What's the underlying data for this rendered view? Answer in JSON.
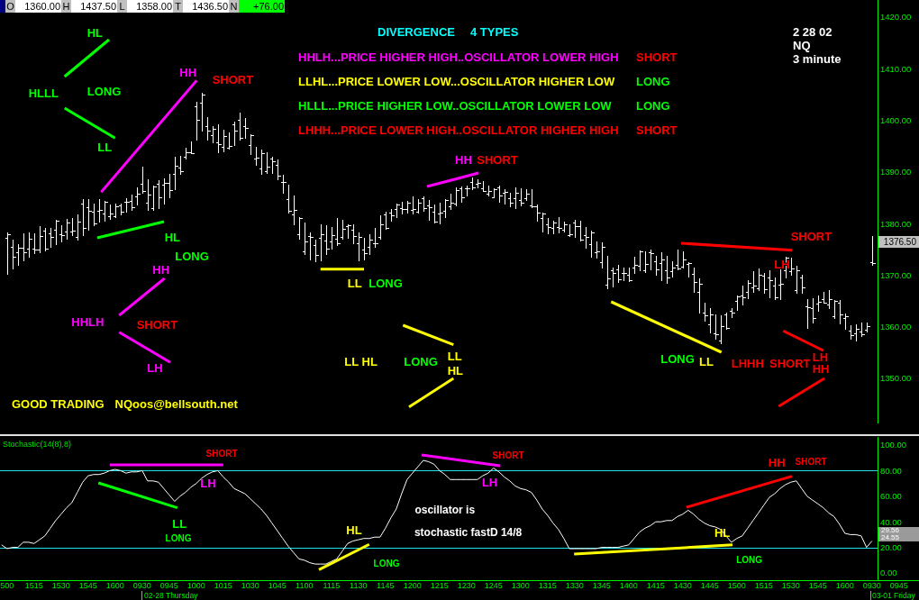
{
  "quote_bar": [
    {
      "label": "O",
      "value": "1360.00",
      "color": "#ffffff"
    },
    {
      "label": "H",
      "value": "1437.50",
      "color": "#ffffff"
    },
    {
      "label": "L",
      "value": "1358.00",
      "color": "#ffffff"
    },
    {
      "label": "T",
      "value": "1436.50",
      "color": "#ffffff"
    },
    {
      "label": "N",
      "value": "+76.00",
      "color": "#00ff00"
    }
  ],
  "price_chart": {
    "legend": {
      "title": "DIVERGENCE",
      "subtitle": "4 TYPES",
      "rows": [
        {
          "text": "HHLH...PRICE HIGHER HIGH..OSCILLATOR LOWER HIGH",
          "color": "#ff00ff",
          "signal": {
            "text": "SHORT",
            "color": "#ff0000"
          }
        },
        {
          "text": "LLHL...PRICE LOWER LOW...OSCILLATOR HIGHER LOW",
          "color": "#ffff00",
          "signal": {
            "text": "LONG",
            "color": "#00ff00"
          }
        },
        {
          "text": "HLLL...PRICE HIGHER LOW..OSCILLATOR LOWER LOW",
          "color": "#00ff00",
          "signal": {
            "text": "LONG",
            "color": "#00ff00"
          }
        },
        {
          "text": "LHHH...PRICE LOWER HIGH..OSCILLATOR HIGHER HIGH",
          "color": "#ff0000",
          "signal": {
            "text": "SHORT",
            "color": "#ff0000"
          }
        }
      ]
    },
    "info": [
      "2 28 02",
      "NQ",
      "3 minute"
    ],
    "labels": [
      {
        "text": "HL",
        "color": "#00ff00"
      },
      {
        "text": "HH",
        "color": "#ff00ff"
      },
      {
        "text": "SHORT",
        "color": "#ff0000"
      },
      {
        "text": "HLLL",
        "color": "#00ff00"
      },
      {
        "text": "LONG",
        "color": "#00ff00"
      },
      {
        "text": "LL",
        "color": "#00ff00"
      },
      {
        "text": "HH",
        "color": "#ff00ff"
      },
      {
        "text": "SHORT",
        "color": "#ff0000"
      },
      {
        "text": "HL",
        "color": "#00ff00"
      },
      {
        "text": "SHORT",
        "color": "#ff0000"
      },
      {
        "text": "LONG",
        "color": "#00ff00"
      },
      {
        "text": "HH",
        "color": "#ff00ff"
      },
      {
        "text": "LH",
        "color": "#ff0000"
      },
      {
        "text": "LL",
        "color": "#ffff00"
      },
      {
        "text": "LONG",
        "color": "#00ff00"
      },
      {
        "text": "HHLH",
        "color": "#ff00ff"
      },
      {
        "text": "SHORT",
        "color": "#ff0000"
      },
      {
        "text": "LH",
        "color": "#ff00ff"
      },
      {
        "text": "LL HL",
        "color": "#ffff00"
      },
      {
        "text": "LONG",
        "color": "#00ff00"
      },
      {
        "text": "LL",
        "color": "#ffff00"
      },
      {
        "text": "HL",
        "color": "#ffff00"
      },
      {
        "text": "LONG",
        "color": "#00ff00"
      },
      {
        "text": "LL",
        "color": "#ffff00"
      },
      {
        "text": "LHHH",
        "color": "#ff0000"
      },
      {
        "text": "SHORT",
        "color": "#ff0000"
      },
      {
        "text": "LH",
        "color": "#ff0000"
      },
      {
        "text": "HH",
        "color": "#ff0000"
      }
    ],
    "lines": [
      {
        "color": "#00ff00"
      },
      {
        "color": "#ff00ff"
      },
      {
        "color": "#00ff00"
      },
      {
        "color": "#ff00ff"
      },
      {
        "color": "#00ff00"
      },
      {
        "color": "#ff0000"
      },
      {
        "color": "#ffff00"
      },
      {
        "color": "#ffff00"
      },
      {
        "color": "#ff00ff"
      },
      {
        "color": "#ffff00"
      },
      {
        "color": "#ff0000"
      },
      {
        "color": "#ff00ff"
      },
      {
        "color": "#ff0000"
      },
      {
        "color": "#ffff00"
      }
    ],
    "footer": [
      "GOOD TRADING",
      "NQoos@bellsouth.net"
    ],
    "axis_labels": [
      "1420.00",
      "1410.00",
      "1400.00",
      "1390.00",
      "1380.00",
      "1370.00",
      "1360.00",
      "1350.00"
    ],
    "last_price": "1376.50"
  },
  "stochastic": {
    "value_tags": [
      "29.56",
      "24.55"
    ],
    "date_labels": [
      "02-28 Thursday",
      "03-01 Friday"
    ],
    "labels": [
      {
        "kind": "signal",
        "text": "SHORT",
        "color": "#ff0000"
      },
      {
        "kind": "signal",
        "text": "SHORT",
        "color": "#ff0000"
      },
      {
        "kind": "label",
        "text": "HH",
        "color": "#ff0000"
      },
      {
        "kind": "signal",
        "text": "SHORT",
        "color": "#ff0000"
      },
      {
        "kind": "label",
        "text": "LH",
        "color": "#ff00ff"
      },
      {
        "kind": "label",
        "text": "LH",
        "color": "#ff00ff"
      },
      {
        "kind": "caption",
        "text": "oscillator is",
        "color": "#ffffff"
      },
      {
        "kind": "label",
        "text": "LL",
        "color": "#00ff00"
      },
      {
        "kind": "signal",
        "text": "LONG",
        "color": "#00ff00"
      },
      {
        "kind": "label",
        "text": "HL",
        "color": "#ffff00"
      },
      {
        "kind": "caption",
        "text": "stochastic fastD 14/8",
        "color": "#ffffff"
      },
      {
        "kind": "label",
        "text": "HL",
        "color": "#ffff00"
      },
      {
        "kind": "signal",
        "text": "LONG",
        "color": "#00ff00"
      },
      {
        "kind": "signal",
        "text": "LONG",
        "color": "#00ff00"
      }
    ],
    "lines": [
      {
        "color": "#ff00ff"
      },
      {
        "color": "#00ff00"
      },
      {
        "color": "#ffff00"
      },
      {
        "color": "#ff00ff"
      },
      {
        "color": "#ffff00"
      },
      {
        "color": "#ff0000"
      }
    ],
    "chart_data": {
      "type": "line",
      "title": "Stochastic(14(8),8)",
      "ylim": [
        -5.63,
        106.34
      ],
      "categories": [
        null,
        "500",
        null,
        null,
        null,
        null,
        "1515",
        null,
        null,
        null,
        null,
        "1530",
        null,
        null,
        null,
        null,
        "1545",
        null,
        null,
        null,
        null,
        "1600",
        null,
        null,
        null,
        null,
        "0930",
        null,
        null,
        null,
        null,
        "0945",
        null,
        null,
        null,
        null,
        "1000",
        null,
        null,
        null,
        null,
        "1015",
        null,
        null,
        null,
        null,
        "1030",
        null,
        null,
        null,
        null,
        "1045",
        null,
        null,
        null,
        null,
        "1100",
        null,
        null,
        null,
        null,
        "1115",
        null,
        null,
        null,
        null,
        "1130",
        null,
        null,
        null,
        null,
        "1145",
        null,
        null,
        null,
        null,
        "1200",
        null,
        null,
        null,
        null,
        "1215",
        null,
        null,
        null,
        null,
        "1230",
        null,
        null,
        null,
        null,
        "1245",
        null,
        null,
        null,
        null,
        "1300",
        null,
        null,
        null,
        null,
        "1315",
        null,
        null,
        null,
        null,
        "1330",
        null,
        null,
        null,
        null,
        "1345",
        null,
        null,
        null,
        null,
        "1400",
        null,
        null,
        null,
        null,
        "1415",
        null,
        null,
        null,
        null,
        "1430",
        null,
        null,
        null,
        null,
        "1445",
        null,
        null,
        null,
        null,
        "1500",
        null,
        null,
        null,
        null,
        "1515",
        null,
        null,
        null,
        null,
        "1530",
        null,
        null,
        null,
        null,
        "1545",
        null,
        null,
        null,
        null,
        "1600",
        null,
        null,
        null,
        null,
        "0930",
        null,
        null,
        null,
        null,
        "0945"
      ],
      "yticks": [
        {
          "value": 100,
          "label": "100.00"
        },
        {
          "value": 80,
          "label": "80.00"
        },
        {
          "value": 60,
          "label": "60.00"
        },
        {
          "value": 40,
          "label": "40.00"
        },
        {
          "value": 20,
          "label": "20.00"
        },
        {
          "value": 0,
          "label": "0.00"
        }
      ],
      "series": [
        {
          "color": "#ffffff",
          "values": [
            22,
            19,
            20,
            20,
            24,
            24,
            23,
            26,
            29,
            35,
            41,
            46,
            51,
            55,
            63,
            71,
            76,
            77,
            77,
            78,
            80,
            81,
            80,
            78,
            79,
            79,
            80,
            72,
            72,
            71,
            66,
            61,
            56,
            60,
            63,
            67,
            70,
            74,
            77,
            79,
            80,
            75,
            71,
            66,
            64,
            62,
            58,
            54,
            50,
            45,
            39,
            33,
            27,
            21,
            16,
            11,
            10,
            8,
            7,
            7,
            7,
            9,
            11,
            17,
            23,
            25,
            26,
            27,
            27,
            28,
            28,
            35,
            43,
            50,
            62,
            73,
            78,
            83,
            88,
            87,
            85,
            80,
            77,
            73,
            73,
            73,
            73,
            73,
            73,
            76,
            78,
            82,
            79,
            75,
            72,
            68,
            66,
            65,
            63,
            57,
            50,
            45,
            39,
            34,
            27,
            19,
            19,
            19,
            19,
            19,
            19,
            20,
            20,
            20,
            20,
            21,
            22,
            27,
            32,
            35,
            37,
            40,
            40,
            41,
            41,
            44,
            46,
            49,
            46,
            42,
            39,
            37,
            36,
            34,
            29,
            24,
            27,
            29,
            35,
            41,
            47,
            53,
            59,
            62,
            66,
            69,
            71,
            72,
            66,
            60,
            57,
            54,
            51,
            47,
            44,
            38,
            31,
            30,
            30,
            29,
            20,
            25,
            null,
            null,
            null,
            null,
            null
          ]
        }
      ],
      "ref_lines": [
        {
          "axis": "y",
          "value": 80
        },
        {
          "axis": "y",
          "value": 20
        }
      ]
    }
  }
}
